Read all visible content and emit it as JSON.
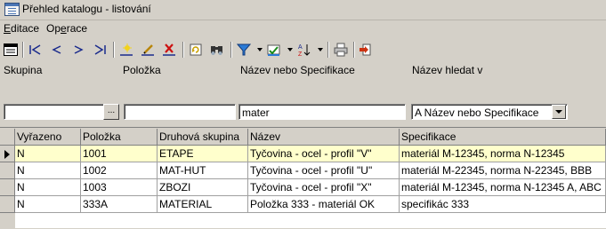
{
  "window": {
    "title": "Přehled katalogu - listování"
  },
  "menu": [
    {
      "label": "Editace",
      "underline": "E",
      "rest": "ditace"
    },
    {
      "label": "Operace",
      "underline": "e",
      "rest": "Op|race"
    }
  ],
  "toolbar": {
    "icons": [
      "grid-view-icon",
      "first-record-icon",
      "prev-record-icon",
      "next-record-icon",
      "last-record-icon",
      "new-record-icon",
      "edit-record-icon",
      "delete-record-icon",
      "refresh-icon",
      "find-icon",
      "filter-icon",
      "filter-options-icon",
      "sort-icon",
      "print-icon",
      "exit-icon"
    ]
  },
  "filters": {
    "group_label": "Skupina",
    "item_label": "Položka",
    "name_label": "Název nebo Specifikace",
    "search_in_label": "Název hledat v",
    "group_value": "",
    "group_browse": "...",
    "item_value": "",
    "name_value": "mater",
    "search_in_value": "A  Název nebo Specifikace"
  },
  "table": {
    "columns": [
      "Vyřazeno",
      "Položka",
      "Druhová skupina",
      "Název",
      "Specifikace"
    ],
    "rows": [
      [
        "N",
        "1001",
        "ETAPE",
        "Tyčovina - ocel - profil \"V\"",
        "materiál M-12345, norma N-12345"
      ],
      [
        "N",
        "1002",
        "MAT-HUT",
        "Tyčovina - ocel - profil \"U\"",
        "materiál M-22345, norma N-22345, BBB"
      ],
      [
        "N",
        "1003",
        "ZBOZI",
        "Tyčovina - ocel - profil \"X\"",
        "materiál M-12345, norma N-12345 A, ABC"
      ],
      [
        "N",
        "333A",
        "MATERIAL",
        "Položka 333 - materiál OK",
        "specifikác 333"
      ]
    ],
    "selected_row": 0
  }
}
